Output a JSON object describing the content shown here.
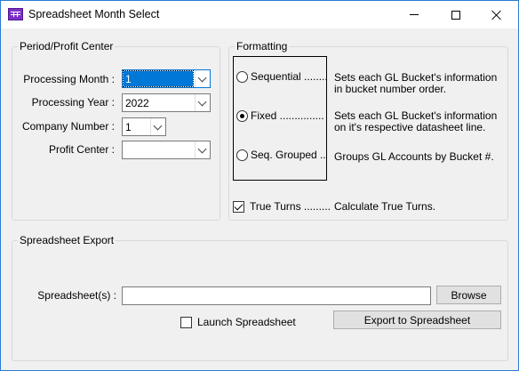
{
  "window": {
    "title": "Spreadsheet Month Select",
    "app_icon": "spreadsheet-icon",
    "controls": {
      "minimize": "minimize-icon",
      "maximize": "maximize-icon",
      "close": "close-icon"
    }
  },
  "period_group": {
    "title": "Period/Profit Center",
    "processing_month": {
      "label": "Processing Month :",
      "value": "1"
    },
    "processing_year": {
      "label": "Processing Year :",
      "value": "2022"
    },
    "company_number": {
      "label": "Company Number :",
      "value": "1"
    },
    "profit_center": {
      "label": "Profit Center :",
      "value": ""
    }
  },
  "formatting_group": {
    "title": "Formatting",
    "options": [
      {
        "label": "Sequential ........",
        "description": "Sets each GL Bucket's information in bucket number order.",
        "checked": false
      },
      {
        "label": "Fixed ...............",
        "description": "Sets each GL Bucket's information on it's respective datasheet line.",
        "checked": true
      },
      {
        "label": "Seq. Grouped ..",
        "description": "Groups GL Accounts by Bucket #.",
        "checked": false
      }
    ],
    "true_turns": {
      "label": "True Turns .........",
      "description": "Calculate True Turns.",
      "checked": true
    }
  },
  "export_group": {
    "title": "Spreadsheet Export",
    "spreadsheets_label": "Spreadsheet(s) :",
    "spreadsheets_value": "",
    "browse_label": "Browse",
    "launch_label": "Launch Spreadsheet",
    "launch_checked": false,
    "export_label": "Export to Spreadsheet"
  }
}
